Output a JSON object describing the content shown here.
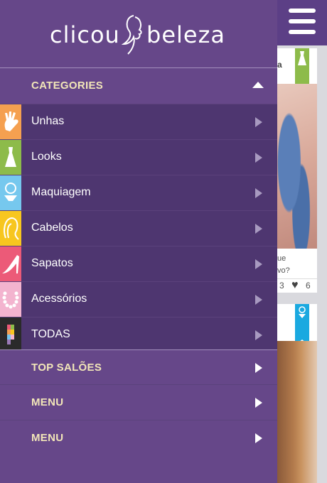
{
  "app": {
    "logo_left": "clicou",
    "logo_right": "beleza"
  },
  "colors": {
    "drawer_bg": "#664789",
    "category_bg": "#4e3670",
    "header_text": "#f2e6b8"
  },
  "categories_header": {
    "label": "CATEGORIES",
    "icon": "chevron-up-icon"
  },
  "categories": [
    {
      "label": "Unhas",
      "icon": "hand-icon",
      "color": "#f5a050"
    },
    {
      "label": "Looks",
      "icon": "dress-icon",
      "color": "#8dbb4a"
    },
    {
      "label": "Maquiagem",
      "icon": "makeup-icon",
      "color": "#76c8ee"
    },
    {
      "label": "Cabelos",
      "icon": "hair-icon",
      "color": "#f7c61f"
    },
    {
      "label": "Sapatos",
      "icon": "shoe-icon",
      "color": "#ec5a78"
    },
    {
      "label": "Acessórios",
      "icon": "necklace-icon",
      "color": "#f3b4cf"
    },
    {
      "label": "TODAS",
      "icon": "all-icon",
      "color": "#2a2a2a"
    }
  ],
  "sections": [
    {
      "label": "TOP SALÕES"
    },
    {
      "label": "MENU"
    },
    {
      "label": "MENU"
    }
  ],
  "background": {
    "card1": {
      "header_fragment": "a",
      "text_line1": "ue",
      "text_line2": "vo?",
      "count_a": "3",
      "count_b": "6"
    }
  }
}
